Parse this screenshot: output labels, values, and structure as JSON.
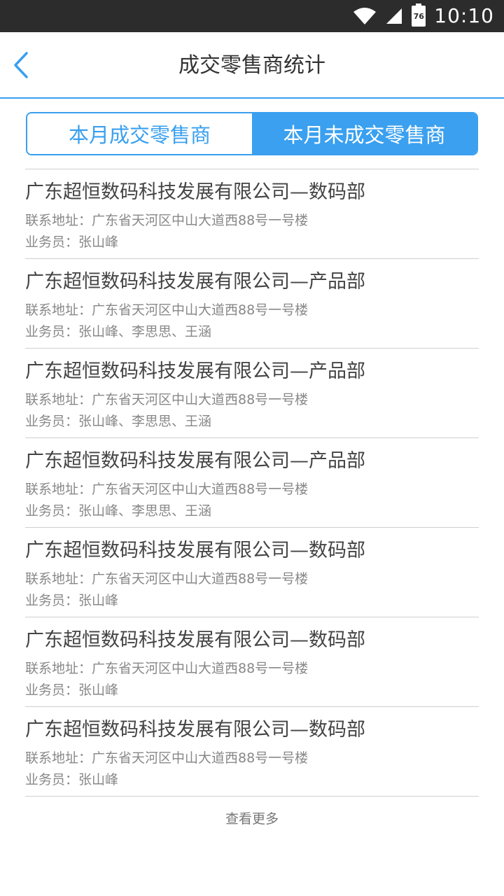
{
  "status_bar": {
    "time": "10:10",
    "battery_level": "76",
    "icons": [
      "wifi-icon",
      "signal-icon",
      "battery-icon"
    ]
  },
  "header": {
    "title": "成交零售商统计",
    "back_icon": "chevron-left-icon"
  },
  "tabs": [
    {
      "label": "本月成交零售商",
      "active": false
    },
    {
      "label": "本月未成交零售商",
      "active": true
    }
  ],
  "list": {
    "items": [
      {
        "title": "广东超恒数码科技发展有限公司—数码部",
        "address": "联系地址：广东省天河区中山大道西88号一号楼",
        "staff": "业务员：张山峰"
      },
      {
        "title": "广东超恒数码科技发展有限公司—产品部",
        "address": "联系地址：广东省天河区中山大道西88号一号楼",
        "staff": "业务员：张山峰、李思思、王涵"
      },
      {
        "title": "广东超恒数码科技发展有限公司—产品部",
        "address": "联系地址：广东省天河区中山大道西88号一号楼",
        "staff": "业务员：张山峰、李思思、王涵"
      },
      {
        "title": "广东超恒数码科技发展有限公司—产品部",
        "address": "联系地址：广东省天河区中山大道西88号一号楼",
        "staff": "业务员：张山峰、李思思、王涵"
      },
      {
        "title": "广东超恒数码科技发展有限公司—数码部",
        "address": "联系地址：广东省天河区中山大道西88号一号楼",
        "staff": "业务员：张山峰"
      },
      {
        "title": "广东超恒数码科技发展有限公司—数码部",
        "address": "联系地址：广东省天河区中山大道西88号一号楼",
        "staff": "业务员：张山峰"
      },
      {
        "title": "广东超恒数码科技发展有限公司—数码部",
        "address": "联系地址：广东省天河区中山大道西88号一号楼",
        "staff": "业务员：张山峰"
      }
    ],
    "load_more": "查看更多"
  },
  "colors": {
    "accent": "#3aa0ef",
    "status_bar": "#2c2c2c",
    "divider": "#cfcfcf"
  }
}
